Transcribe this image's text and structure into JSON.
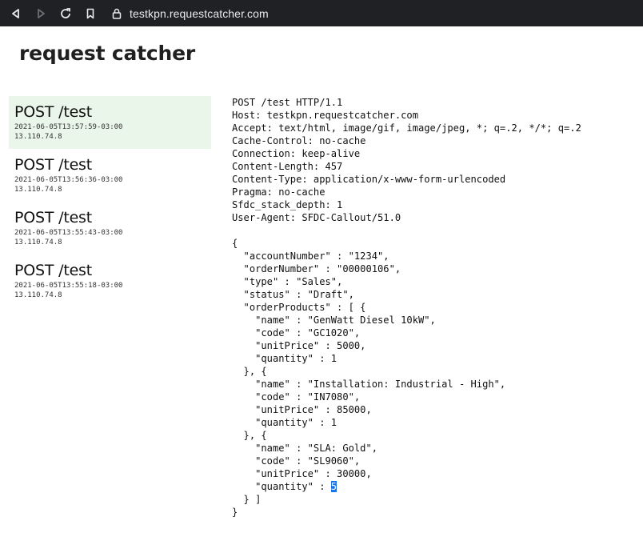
{
  "browser": {
    "url": "testkpn.requestcatcher.com"
  },
  "page": {
    "title": "request catcher"
  },
  "requests": [
    {
      "method": "POST /test",
      "timestamp": "2021-06-05T13:57:59-03:00",
      "ip": "13.110.74.8"
    },
    {
      "method": "POST /test",
      "timestamp": "2021-06-05T13:56:36-03:00",
      "ip": "13.110.74.8"
    },
    {
      "method": "POST /test",
      "timestamp": "2021-06-05T13:55:43-03:00",
      "ip": "13.110.74.8"
    },
    {
      "method": "POST /test",
      "timestamp": "2021-06-05T13:55:18-03:00",
      "ip": "13.110.74.8"
    }
  ],
  "detail": {
    "body": "POST /test HTTP/1.1\nHost: testkpn.requestcatcher.com\nAccept: text/html, image/gif, image/jpeg, *; q=.2, */*; q=.2\nCache-Control: no-cache\nConnection: keep-alive\nContent-Length: 457\nContent-Type: application/x-www-form-urlencoded\nPragma: no-cache\nSfdc_stack_depth: 1\nUser-Agent: SFDC-Callout/51.0\n\n{\n  \"accountNumber\" : \"1234\",\n  \"orderNumber\" : \"00000106\",\n  \"type\" : \"Sales\",\n  \"status\" : \"Draft\",\n  \"orderProducts\" : [ {\n    \"name\" : \"GenWatt Diesel 10kW\",\n    \"code\" : \"GC1020\",\n    \"unitPrice\" : 5000,\n    \"quantity\" : 1\n  }, {\n    \"name\" : \"Installation: Industrial - High\",\n    \"code\" : \"IN7080\",\n    \"unitPrice\" : 85000,\n    \"quantity\" : 1\n  }, {\n    \"name\" : \"SLA: Gold\",\n    \"code\" : \"SL9060\",\n    \"unitPrice\" : 30000,\n    \"quantity\" : ",
    "selected": "5",
    "tail": "\n  } ]\n}"
  }
}
